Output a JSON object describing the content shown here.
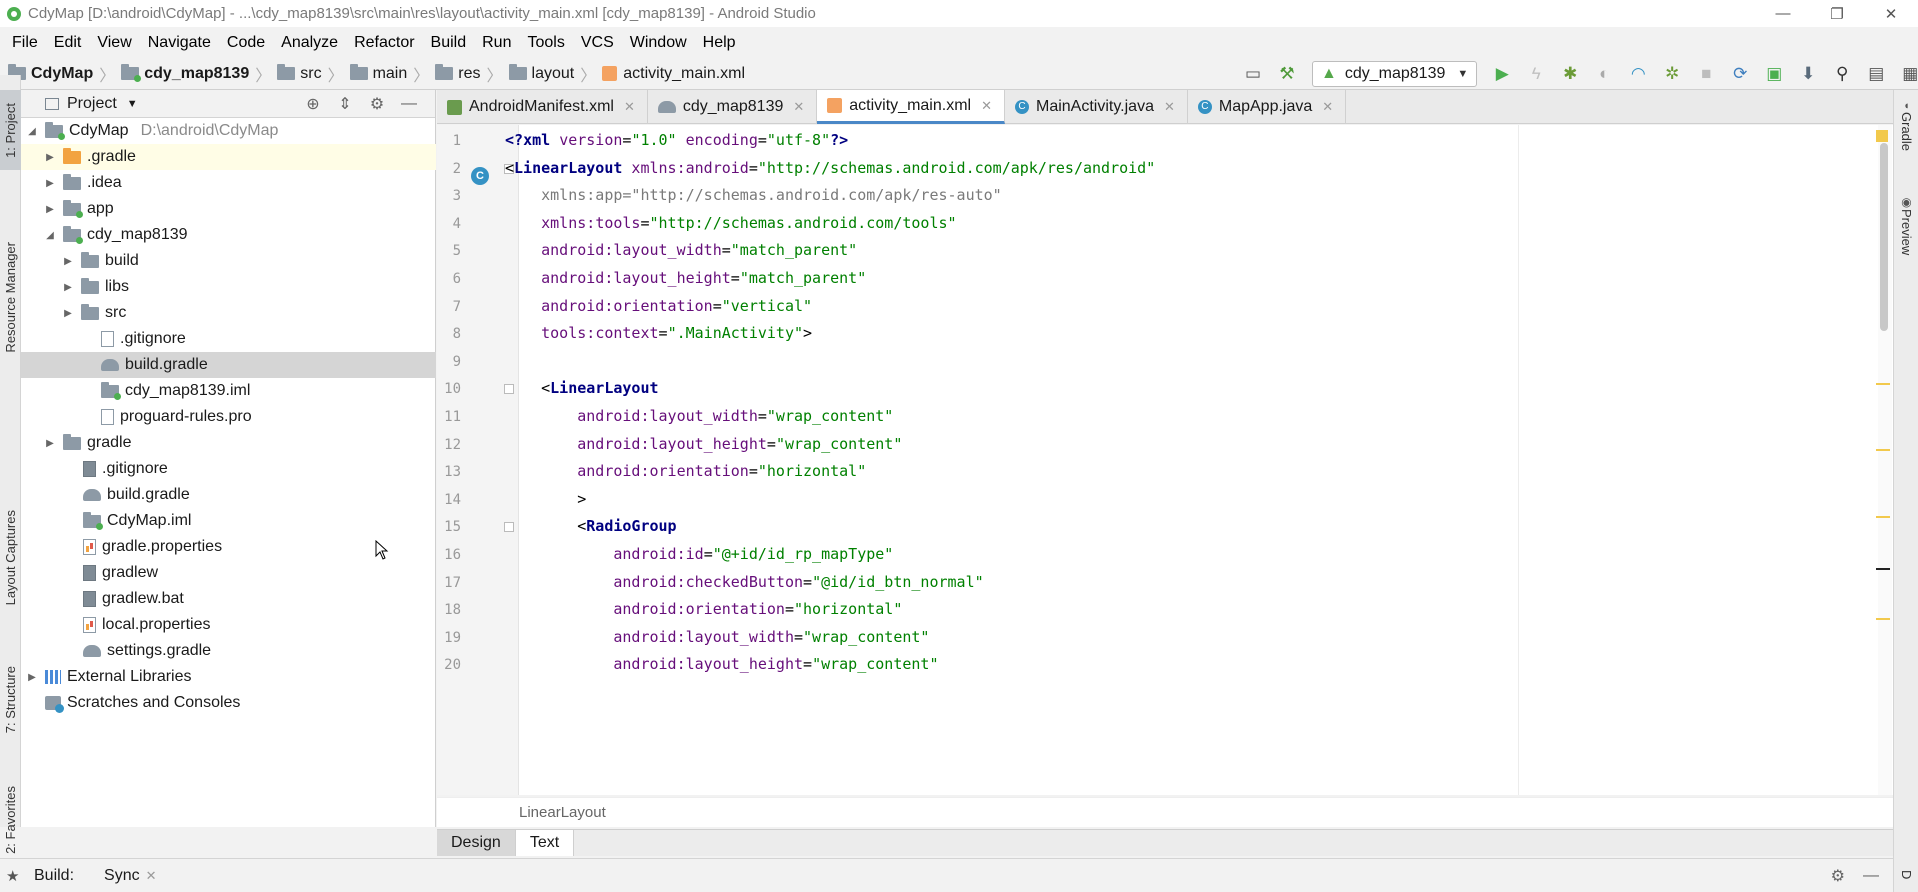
{
  "window": {
    "title": "CdyMap [D:\\android\\CdyMap] - ...\\cdy_map8139\\src\\main\\res\\layout\\activity_main.xml [cdy_map8139] - Android Studio",
    "minimize": "—",
    "maximize": "❐",
    "close": "✕"
  },
  "menu": [
    "File",
    "Edit",
    "View",
    "Navigate",
    "Code",
    "Analyze",
    "Refactor",
    "Build",
    "Run",
    "Tools",
    "VCS",
    "Window",
    "Help"
  ],
  "navbar": {
    "crumbs": [
      "CdyMap",
      "cdy_map8139",
      "src",
      "main",
      "res",
      "layout",
      "activity_main.xml"
    ],
    "run_config": "cdy_map8139"
  },
  "left_strip": {
    "tabs": [
      "1: Project",
      "Resource Manager",
      "Layout Captures",
      "7: Structure",
      "2: Favorites"
    ]
  },
  "project_panel": {
    "title": "Project",
    "tree": [
      {
        "label": "CdyMap",
        "path": "D:\\android\\CdyMap"
      },
      {
        "label": ".gradle"
      },
      {
        "label": ".idea"
      },
      {
        "label": "app"
      },
      {
        "label": "cdy_map8139"
      },
      {
        "label": "build"
      },
      {
        "label": "libs"
      },
      {
        "label": "src"
      },
      {
        "label": ".gitignore"
      },
      {
        "label": "build.gradle"
      },
      {
        "label": "cdy_map8139.iml"
      },
      {
        "label": "proguard-rules.pro"
      },
      {
        "label": "gradle"
      },
      {
        "label": ".gitignore"
      },
      {
        "label": "build.gradle"
      },
      {
        "label": "CdyMap.iml"
      },
      {
        "label": "gradle.properties"
      },
      {
        "label": "gradlew"
      },
      {
        "label": "gradlew.bat"
      },
      {
        "label": "local.properties"
      },
      {
        "label": "settings.gradle"
      },
      {
        "label": "External Libraries"
      },
      {
        "label": "Scratches and Consoles"
      }
    ]
  },
  "editor_tabs": [
    "AndroidManifest.xml",
    "cdy_map8139",
    "activity_main.xml",
    "MainActivity.java",
    "MapApp.java"
  ],
  "editor": {
    "lines": [
      {
        "n": "1",
        "parts": [
          {
            "t": "<?",
            "c": "c-tag"
          },
          {
            "t": "xml ",
            "c": "c-tag"
          },
          {
            "t": "version",
            "c": "c-attr"
          },
          {
            "t": "=",
            "c": ""
          },
          {
            "t": "\"1.0\"",
            "c": "c-val"
          },
          {
            "t": " encoding",
            "c": "c-attr"
          },
          {
            "t": "=",
            "c": ""
          },
          {
            "t": "\"utf-8\"",
            "c": "c-val"
          },
          {
            "t": "?>",
            "c": "c-tag"
          }
        ]
      },
      {
        "n": "2",
        "parts": [
          {
            "t": "<",
            "c": ""
          },
          {
            "t": "LinearLayout",
            "c": "c-tag"
          },
          {
            "t": " xmlns:",
            "c": "c-ns"
          },
          {
            "t": "android",
            "c": "c-attr"
          },
          {
            "t": "=",
            "c": ""
          },
          {
            "t": "\"http://schemas.android.com/apk/res/android\"",
            "c": "c-val"
          }
        ]
      },
      {
        "n": "3",
        "parts": [
          {
            "t": "    xmlns:app=\"http://schemas.android.com/apk/res-auto\"",
            "c": "c-dim"
          }
        ]
      },
      {
        "n": "4",
        "parts": [
          {
            "t": "    xmlns:",
            "c": "c-ns"
          },
          {
            "t": "tools",
            "c": "c-attr"
          },
          {
            "t": "=",
            "c": ""
          },
          {
            "t": "\"http://schemas.android.com/tools\"",
            "c": "c-val"
          }
        ]
      },
      {
        "n": "5",
        "parts": [
          {
            "t": "    android:",
            "c": "c-ns"
          },
          {
            "t": "layout_width",
            "c": "c-attr"
          },
          {
            "t": "=",
            "c": ""
          },
          {
            "t": "\"match_parent\"",
            "c": "c-val"
          }
        ]
      },
      {
        "n": "6",
        "parts": [
          {
            "t": "    android:",
            "c": "c-ns"
          },
          {
            "t": "layout_height",
            "c": "c-attr"
          },
          {
            "t": "=",
            "c": ""
          },
          {
            "t": "\"match_parent\"",
            "c": "c-val"
          }
        ]
      },
      {
        "n": "7",
        "parts": [
          {
            "t": "    android:",
            "c": "c-ns"
          },
          {
            "t": "orientation",
            "c": "c-attr"
          },
          {
            "t": "=",
            "c": ""
          },
          {
            "t": "\"vertical\"",
            "c": "c-val"
          }
        ]
      },
      {
        "n": "8",
        "parts": [
          {
            "t": "    tools:",
            "c": "c-ns"
          },
          {
            "t": "context",
            "c": "c-attr"
          },
          {
            "t": "=",
            "c": ""
          },
          {
            "t": "\".MainActivity\"",
            "c": "c-val"
          },
          {
            "t": ">",
            "c": ""
          }
        ]
      },
      {
        "n": "9",
        "parts": []
      },
      {
        "n": "10",
        "parts": [
          {
            "t": "    <",
            "c": ""
          },
          {
            "t": "LinearLayout",
            "c": "c-tag"
          }
        ]
      },
      {
        "n": "11",
        "parts": [
          {
            "t": "        android:",
            "c": "c-ns"
          },
          {
            "t": "layout_width",
            "c": "c-attr"
          },
          {
            "t": "=",
            "c": ""
          },
          {
            "t": "\"wrap_content\"",
            "c": "c-val"
          }
        ]
      },
      {
        "n": "12",
        "parts": [
          {
            "t": "        android:",
            "c": "c-ns"
          },
          {
            "t": "layout_height",
            "c": "c-attr"
          },
          {
            "t": "=",
            "c": ""
          },
          {
            "t": "\"wrap_content\"",
            "c": "c-val"
          }
        ]
      },
      {
        "n": "13",
        "parts": [
          {
            "t": "        android:",
            "c": "c-ns"
          },
          {
            "t": "orientation",
            "c": "c-attr"
          },
          {
            "t": "=",
            "c": ""
          },
          {
            "t": "\"horizontal\"",
            "c": "c-val"
          }
        ]
      },
      {
        "n": "14",
        "parts": [
          {
            "t": "        >",
            "c": ""
          }
        ]
      },
      {
        "n": "15",
        "parts": [
          {
            "t": "        <",
            "c": ""
          },
          {
            "t": "RadioGroup",
            "c": "c-tag"
          }
        ]
      },
      {
        "n": "16",
        "parts": [
          {
            "t": "            android:",
            "c": "c-ns"
          },
          {
            "t": "id",
            "c": "c-attr"
          },
          {
            "t": "=",
            "c": ""
          },
          {
            "t": "\"@+id/id_rp_mapType\"",
            "c": "c-val"
          }
        ]
      },
      {
        "n": "17",
        "parts": [
          {
            "t": "            android:",
            "c": "c-ns"
          },
          {
            "t": "checkedButton",
            "c": "c-attr"
          },
          {
            "t": "=",
            "c": ""
          },
          {
            "t": "\"@id/id_btn_normal\"",
            "c": "c-val"
          }
        ]
      },
      {
        "n": "18",
        "parts": [
          {
            "t": "            android:",
            "c": "c-ns"
          },
          {
            "t": "orientation",
            "c": "c-attr"
          },
          {
            "t": "=",
            "c": ""
          },
          {
            "t": "\"horizontal\"",
            "c": "c-val"
          }
        ]
      },
      {
        "n": "19",
        "parts": [
          {
            "t": "            android:",
            "c": "c-ns"
          },
          {
            "t": "layout_width",
            "c": "c-attr"
          },
          {
            "t": "=",
            "c": ""
          },
          {
            "t": "\"wrap_content\"",
            "c": "c-val"
          }
        ]
      },
      {
        "n": "20",
        "parts": [
          {
            "t": "            android:",
            "c": "c-ns"
          },
          {
            "t": "layout_height",
            "c": "c-attr"
          },
          {
            "t": "=",
            "c": ""
          },
          {
            "t": "\"wrap_content\"",
            "c": "c-val"
          }
        ]
      }
    ],
    "breadcrumb": "LinearLayout"
  },
  "design_tabs": [
    "Design",
    "Text"
  ],
  "right_strip": [
    "Gradle",
    "Preview",
    "D"
  ],
  "bottom": {
    "build_label": "Build:",
    "sync_label": "Sync"
  }
}
